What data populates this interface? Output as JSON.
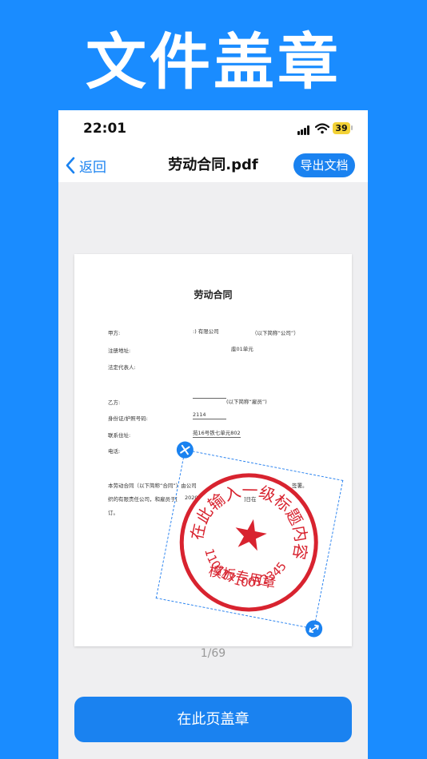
{
  "banner": {
    "title": "文件盖章"
  },
  "status_bar": {
    "time": "22:01",
    "battery": "39"
  },
  "nav": {
    "back_label": "返回",
    "title": "劳动合同.pdf",
    "export_label": "导出文档"
  },
  "document": {
    "heading": "劳动合同",
    "party_a_label": "甲方:",
    "party_a_value": ":) 有限公司",
    "party_a_note": "（以下简称“公司”）",
    "address_label": "注册地址:",
    "address_value": "座01单元",
    "rep_label": "法定代表人:",
    "party_b_label": "乙方:",
    "party_b_note": "(以下简称“雇员”)",
    "id_label": "身份证/护照号码:",
    "id_value": "2114",
    "contact_label": "联系住址:",
    "contact_value": "苑16号铁七单元802",
    "phone_label": "电话:",
    "body_line1": "本劳动合同（以下简称“合同”）由公司",
    "body_line1_tail": "签署。",
    "body_line2": "织的有限责任公司，和雇员于[",
    "body_line2_mid": "2020",
    "body_line2_tail": "]日在",
    "body_line3": "订。"
  },
  "stamp": {
    "top_text": "在此输入一级标题内容",
    "middle_text": "模板专用章",
    "bottom_text": "110117100123​45",
    "star": "★"
  },
  "pagination": {
    "label": "1/69"
  },
  "action": {
    "label": "在此页盖章"
  },
  "colors": {
    "brand": "#1a82f0",
    "banner_bg": "#1a8cff",
    "stamp_red": "#d8232f",
    "battery": "#f3d236"
  },
  "icons": {
    "back": "chevron-left-icon",
    "delete": "close-icon",
    "resize": "resize-icon",
    "wifi": "wifi-icon",
    "signal": "signal-icon"
  }
}
